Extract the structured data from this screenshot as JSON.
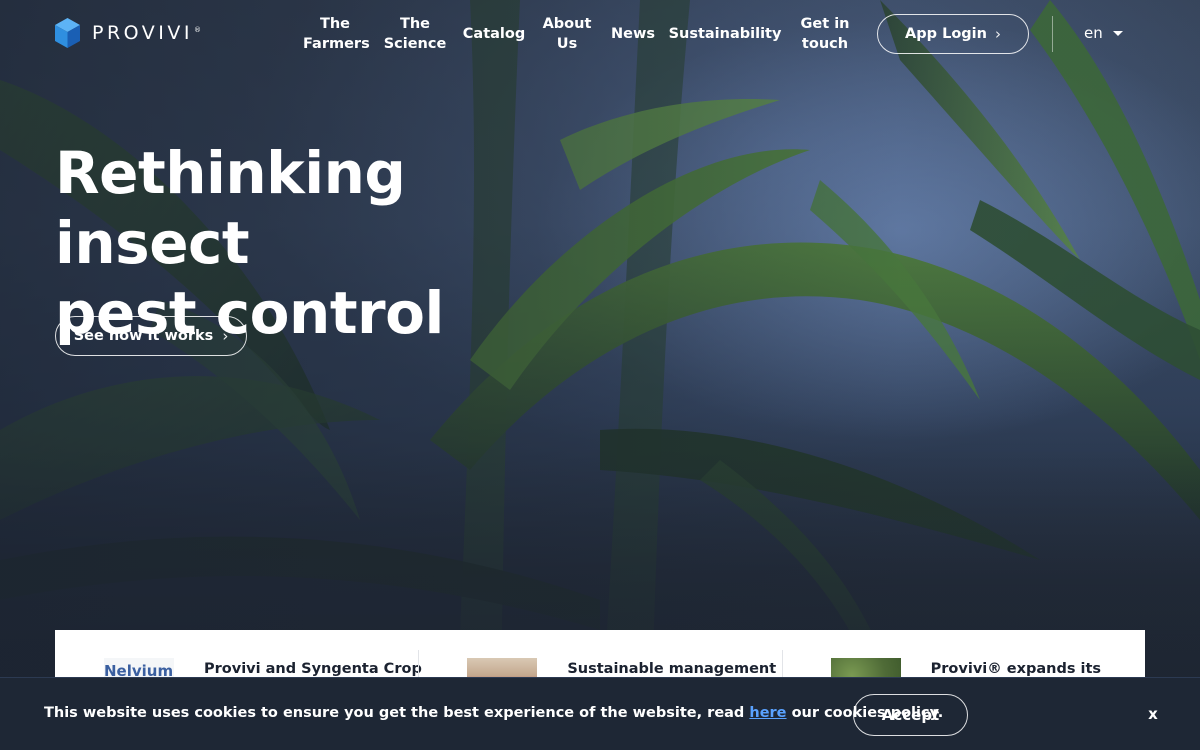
{
  "brand": {
    "name": "PROVIVI",
    "trademark": "®",
    "logo_colors": [
      "#2f8fe0",
      "#1a5fb4",
      "#5db3f5"
    ]
  },
  "nav": {
    "items": [
      {
        "label": "The Farmers"
      },
      {
        "label": "The Science"
      },
      {
        "label": "Catalog"
      },
      {
        "label": "About Us"
      },
      {
        "label": "News"
      },
      {
        "label": "Sustainability"
      },
      {
        "label": "Get in touch"
      }
    ],
    "login_label": "App Login",
    "language": "en"
  },
  "hero": {
    "headline_line1": "Rethinking insect",
    "headline_line2": "pest control",
    "cta_label": "See how it works"
  },
  "news": [
    {
      "thumb_text": "Nelvium",
      "title": "Provivi and Syngenta Crop"
    },
    {
      "thumb_text": "",
      "title": "Sustainable management"
    },
    {
      "thumb_text": "",
      "title": "Provivi® expands its"
    }
  ],
  "cookie": {
    "text_before": "This website uses cookies to ensure you get the best experience of the website, read ",
    "link_label": "here",
    "text_after": " our cookies policy.",
    "accept_label": "Accept",
    "close_label": "x"
  },
  "colors": {
    "hero_overlay": "#1f2836",
    "cookie_bar": "#1e2735",
    "link": "#5aa2ff",
    "news_title": "#1b2230"
  },
  "icons": {
    "chevron": "chevron-right-icon",
    "language_caret": "caret-down-icon"
  }
}
